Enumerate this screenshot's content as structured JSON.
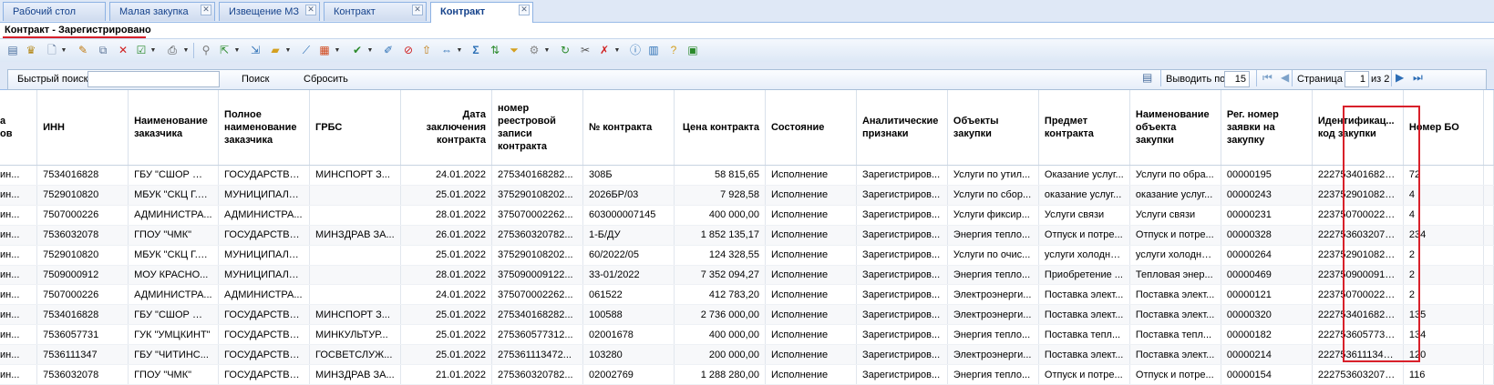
{
  "tabs": [
    {
      "label": "Рабочий стол",
      "closable": false,
      "active": false
    },
    {
      "label": "Малая закупка",
      "closable": true,
      "active": false
    },
    {
      "label": "Извещение МЗ",
      "closable": true,
      "active": false
    },
    {
      "label": "Контракт",
      "closable": true,
      "active": false
    },
    {
      "label": "Контракт",
      "closable": true,
      "active": true
    }
  ],
  "tab_close_glyph": "✕",
  "page_title": "Контракт - Зарегистрировано",
  "toolbar_icons": [
    "table-view-icon",
    "emblem-icon",
    "new-doc-icon",
    "edit-icon",
    "copy-icon",
    "delete-icon",
    "approve-icon",
    "print-icon",
    "attach-icon",
    "export-icon",
    "import-icon",
    "folder-icon",
    "filter-icon",
    "chart-icon",
    "check-icon",
    "pencil-icon",
    "delete-row-icon",
    "upload-icon",
    "link-icon",
    "sum-icon",
    "sort-icon",
    "funnel-icon",
    "process-icon",
    "refresh-icon",
    "tools-icon",
    "clear-filter-icon",
    "info-icon",
    "columns-icon",
    "help-icon",
    "report-icon"
  ],
  "search": {
    "label": "Быстрый поиск",
    "value": "",
    "search_button": "Поиск",
    "reset_button": "Сбросить"
  },
  "paging": {
    "per_page_label": "Выводить по",
    "per_page_value": "15",
    "page_label": "Страница",
    "page_value": "1",
    "of_label": "из 2"
  },
  "grid": {
    "columns": [
      "а\nов",
      "ИНН",
      "Наименование заказчика",
      "Полное наименование заказчика",
      "ГРБС",
      "Дата заключения контракта",
      "номер реестровой записи контракта",
      "№ контракта",
      "Цена контракта",
      "Состояние",
      "Аналитические признаки",
      "Объекты закупки",
      "Предмет контракта",
      "Наименование объекта закупки",
      "Рег. номер заявки на закупку",
      "Идентификац... код закупки",
      "Номер БО",
      ""
    ],
    "rows": [
      [
        "ин...",
        "7534016828",
        "ГБУ \"СШОР № ...",
        "ГОСУДАРСТВЕ...",
        "МИНСПОРТ З...",
        "24.01.2022",
        "275340168282...",
        "308Б",
        "58 815,65",
        "Исполнение",
        "Зарегистриров...",
        "Услуги по утил...",
        "Оказание услуг...",
        "Услуги по обра...",
        "00000195",
        "2227534016828...",
        "72",
        ""
      ],
      [
        "ин...",
        "7529010820",
        "МБУК \"СКЦ Г.Б...",
        "МУНИЦИПАЛЬ...",
        "",
        "25.01.2022",
        "375290108202...",
        "2026БР/03",
        "7 928,58",
        "Исполнение",
        "Зарегистриров...",
        "Услуги по сбор...",
        "оказание услуг...",
        "оказание услуг...",
        "00000243",
        "2237529010820...",
        "4",
        ""
      ],
      [
        "ин...",
        "7507000226",
        "АДМИНИСТРА...",
        "АДМИНИСТРА...",
        "",
        "28.01.2022",
        "375070002262...",
        "603000007145",
        "400 000,00",
        "Исполнение",
        "Зарегистриров...",
        "Услуги фиксир...",
        "Услуги связи",
        "Услуги связи",
        "00000231",
        "2237507000226...",
        "4",
        ""
      ],
      [
        "ин...",
        "7536032078",
        "ГПОУ \"ЧМК\"",
        "ГОСУДАРСТВЕ...",
        "МИНЗДРАВ ЗА...",
        "26.01.2022",
        "275360320782...",
        "1-Б/ДУ",
        "1 852 135,17",
        "Исполнение",
        "Зарегистриров...",
        "Энергия тепло...",
        "Отпуск и потре...",
        "Отпуск и потре...",
        "00000328",
        "2227536032078...",
        "234",
        ""
      ],
      [
        "ин...",
        "7529010820",
        "МБУК \"СКЦ Г.Б...",
        "МУНИЦИПАЛЬ...",
        "",
        "25.01.2022",
        "375290108202...",
        "60/2022/05",
        "124 328,55",
        "Исполнение",
        "Зарегистриров...",
        "Услуги по очис...",
        "услуги холодно...",
        "услуги холодно...",
        "00000264",
        "2237529010820...",
        "2",
        ""
      ],
      [
        "ин...",
        "7509000912",
        "МОУ КРАСНО...",
        "МУНИЦИПАЛЬ...",
        "",
        "28.01.2022",
        "375090009122...",
        "33-01/2022",
        "7 352 094,27",
        "Исполнение",
        "Зарегистриров...",
        "Энергия тепло...",
        "Приобретение ...",
        "Тепловая энер...",
        "00000469",
        "2237509000912...",
        "2",
        ""
      ],
      [
        "ин...",
        "7507000226",
        "АДМИНИСТРА...",
        "АДМИНИСТРА...",
        "",
        "24.01.2022",
        "375070002262...",
        "061522",
        "412 783,20",
        "Исполнение",
        "Зарегистриров...",
        "Электроэнерги...",
        "Поставка элект...",
        "Поставка элект...",
        "00000121",
        "2237507000226...",
        "2",
        ""
      ],
      [
        "ин...",
        "7534016828",
        "ГБУ \"СШОР № ...",
        "ГОСУДАРСТВЕ...",
        "МИНСПОРТ З...",
        "25.01.2022",
        "275340168282...",
        "100588",
        "2 736 000,00",
        "Исполнение",
        "Зарегистриров...",
        "Электроэнерги...",
        "Поставка элект...",
        "Поставка элект...",
        "00000320",
        "2227534016828...",
        "135",
        ""
      ],
      [
        "ин...",
        "7536057731",
        "ГУК \"УМЦКИНТ\"",
        "ГОСУДАРСТВЕ...",
        "МИНКУЛЬТУР...",
        "25.01.2022",
        "275360577312...",
        "02001678",
        "400 000,00",
        "Исполнение",
        "Зарегистриров...",
        "Энергия тепло...",
        "Поставка тепл...",
        "Поставка тепл...",
        "00000182",
        "2227536057731...",
        "134",
        ""
      ],
      [
        "ин...",
        "7536111347",
        "ГБУ \"ЧИТИНС...",
        "ГОСУДАРСТВЕ...",
        "ГОСВЕТСЛУЖ...",
        "25.01.2022",
        "275361113472...",
        "103280",
        "200 000,00",
        "Исполнение",
        "Зарегистриров...",
        "Электроэнерги...",
        "Поставка элект...",
        "Поставка элект...",
        "00000214",
        "2227536111347...",
        "120",
        ""
      ],
      [
        "ин...",
        "7536032078",
        "ГПОУ \"ЧМК\"",
        "ГОСУДАРСТВЕ...",
        "МИНЗДРАВ ЗА...",
        "21.01.2022",
        "275360320782...",
        "02002769",
        "1 288 280,00",
        "Исполнение",
        "Зарегистриров...",
        "Энергия тепло...",
        "Отпуск и потре...",
        "Отпуск и потре...",
        "00000154",
        "2227536032078...",
        "116",
        ""
      ]
    ]
  },
  "colors": {
    "tab_bg": "#dfe8f6",
    "accent_border": "#99bbe8",
    "highlight": "#d8202a"
  }
}
